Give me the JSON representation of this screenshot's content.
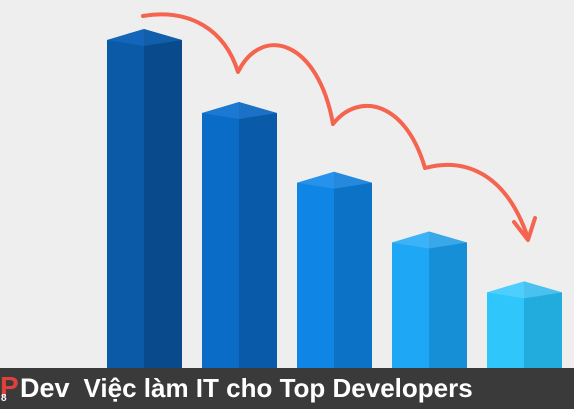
{
  "bars": [
    {
      "level": 1.0,
      "front": "#0a5aa8",
      "side": "#084a8c",
      "top": "#1a70c4"
    },
    {
      "level": 0.78,
      "front": "#0b6cc8",
      "side": "#095aa8",
      "top": "#2a85dc"
    },
    {
      "level": 0.57,
      "front": "#0f86e6",
      "side": "#0c72c6",
      "top": "#3b9cf0"
    },
    {
      "level": 0.39,
      "front": "#1ea7f4",
      "side": "#168fd6",
      "top": "#56bdf8"
    },
    {
      "level": 0.24,
      "front": "#2ec6fb",
      "side": "#22acde",
      "top": "#6ad6fd"
    }
  ],
  "arrow_color": "#f4644e",
  "banner": {
    "logo_letter": "P",
    "logo_sub": "8",
    "logo_text": "Dev",
    "tagline": "Việc làm IT cho Top Developers"
  }
}
